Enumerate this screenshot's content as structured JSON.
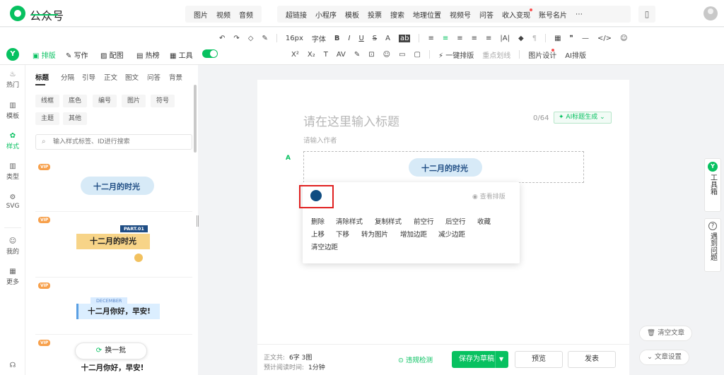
{
  "brand": "公众号",
  "topbar": {
    "group1": [
      "图片",
      "视频",
      "音频"
    ],
    "group2": [
      "超链接",
      "小程序",
      "模板",
      "投票",
      "搜索",
      "地理位置",
      "视频号",
      "问答",
      "收入变现",
      "账号名片",
      "⋯"
    ]
  },
  "toolbar": {
    "row1": [
      "↶",
      "↷",
      "◇",
      "✎",
      "16px",
      "字体",
      "B",
      "I",
      "U",
      "S",
      "A",
      "ab",
      "≡",
      "≡",
      "≡",
      "≡",
      "≡",
      "|A|",
      "◆",
      "¶",
      "▦",
      "❞",
      "—",
      "</>",
      "☺"
    ],
    "row2": [
      "X²",
      "X₂",
      "T",
      "AV",
      "✎",
      "⊡",
      "☺",
      "▭",
      "▢",
      "⚡ 一键排版",
      "重点划线",
      "图片设计",
      "AI排版"
    ]
  },
  "lefttabs": {
    "tab1": "排版",
    "tab2": "写作",
    "tab3": "配图",
    "tab4": "热榜",
    "tab5": "工具"
  },
  "rail": {
    "items": [
      "热门",
      "模板",
      "样式",
      "类型",
      "SVG",
      "我的",
      "更多"
    ]
  },
  "panel": {
    "categories": [
      "标题",
      "分隔",
      "引导",
      "正文",
      "图文",
      "问答",
      "背景"
    ],
    "chips_row1": [
      "线框",
      "底色",
      "编号",
      "图片",
      "符号"
    ],
    "chips_row2": [
      "主题",
      "其他"
    ],
    "search_placeholder": "输入样式标签、ID进行搜索",
    "vip": "VIP",
    "cards": [
      {
        "title": "十二月的时光",
        "tag": ""
      },
      {
        "title": "十二月的时光",
        "tag": "PART.01"
      },
      {
        "title": "十二月你好，早安!",
        "tag": "DECEMBER"
      },
      {
        "title": "十二月你好，早安!",
        "tag": ""
      }
    ],
    "switch_label": "换一批"
  },
  "editor": {
    "title_placeholder": "请在这里输入标题",
    "title_count": "0/64",
    "ai_title": "AI标题生成",
    "author_placeholder": "请输入作者",
    "banner_text": "十二月的时光",
    "marker": "A"
  },
  "popup": {
    "view_layout": "查看排版",
    "row1": [
      "删除",
      "清除样式",
      "复制样式",
      "前空行",
      "后空行",
      "收藏"
    ],
    "row2": [
      "上移",
      "下移",
      "转为图片",
      "增加边距",
      "减少边距"
    ],
    "row3": [
      "清空边距"
    ]
  },
  "bottom": {
    "body_label": "正文共:",
    "body_value": "6字 3图",
    "read_label": "预计阅读时间:",
    "read_value": "1分钟",
    "check": "违规检测",
    "save": "保存为草稿",
    "preview": "预览",
    "publish": "发表"
  },
  "right": {
    "toolbox": "工具箱",
    "problem": "遇到问题",
    "clear": "清空文章",
    "settings": "文章设置"
  },
  "colors": {
    "accent": "#07c160",
    "dot": "#0f4c81",
    "highlight": "#e02020"
  }
}
